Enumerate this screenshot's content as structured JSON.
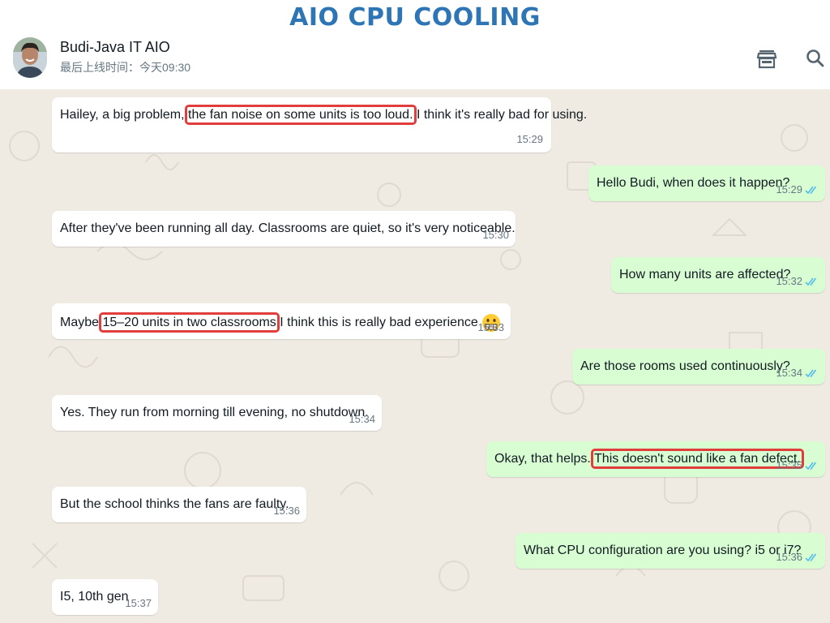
{
  "slide_title": "AIO CPU COOLING",
  "header": {
    "contact_name": "Budi-Java IT AIO",
    "last_seen": "最后上线时间：今天09:30",
    "store_icon": "storefront-icon",
    "search_icon": "search-icon"
  },
  "colors": {
    "title_blue": "#2e75b6",
    "incoming_bubble": "#ffffff",
    "outgoing_bubble": "#d9fdd3",
    "chat_background": "#efeae2",
    "highlight_box": "#e23d3d",
    "read_ticks": "#53bdeb"
  },
  "messages": [
    {
      "dir": "in",
      "pre": "Hailey, a big problem, ",
      "hl": "the fan noise on some units is too loud.",
      "post": " I think it's really bad for using.",
      "time": "15:29"
    },
    {
      "dir": "out",
      "pre": "Hello Budi, when does it happen?",
      "hl": "",
      "post": "",
      "time": "15:29"
    },
    {
      "dir": "in",
      "pre": "After they've been running all day. Classrooms are quiet, so it's very noticeable.",
      "hl": "",
      "post": "",
      "time": "15:30"
    },
    {
      "dir": "out",
      "pre": "How many units are affected?",
      "hl": "",
      "post": "",
      "time": "15:32"
    },
    {
      "dir": "in",
      "pre": "Maybe ",
      "hl": "15–20 units in two classrooms",
      "post": " I think this is really bad experience",
      "time": "15:33",
      "emoji": "grimacing-face-emoji"
    },
    {
      "dir": "out",
      "pre": "Are those rooms used continuously?",
      "hl": "",
      "post": "",
      "time": "15:34"
    },
    {
      "dir": "in",
      "pre": "Yes. They run from morning till evening, no shutdown.",
      "hl": "",
      "post": "",
      "time": "15:34"
    },
    {
      "dir": "out",
      "pre": "Okay, that helps. ",
      "hl": "This doesn't sound like a fan defect.",
      "post": "",
      "time": "15:35"
    },
    {
      "dir": "in",
      "pre": "But the school thinks the fans are faulty.",
      "hl": "",
      "post": "",
      "time": "15:36"
    },
    {
      "dir": "out",
      "pre": "What CPU configuration are you using? i5 or i7?",
      "hl": "",
      "post": "",
      "time": "15:36"
    },
    {
      "dir": "in",
      "pre": "I5, 10th gen",
      "hl": "",
      "post": "",
      "time": "15:37"
    }
  ]
}
